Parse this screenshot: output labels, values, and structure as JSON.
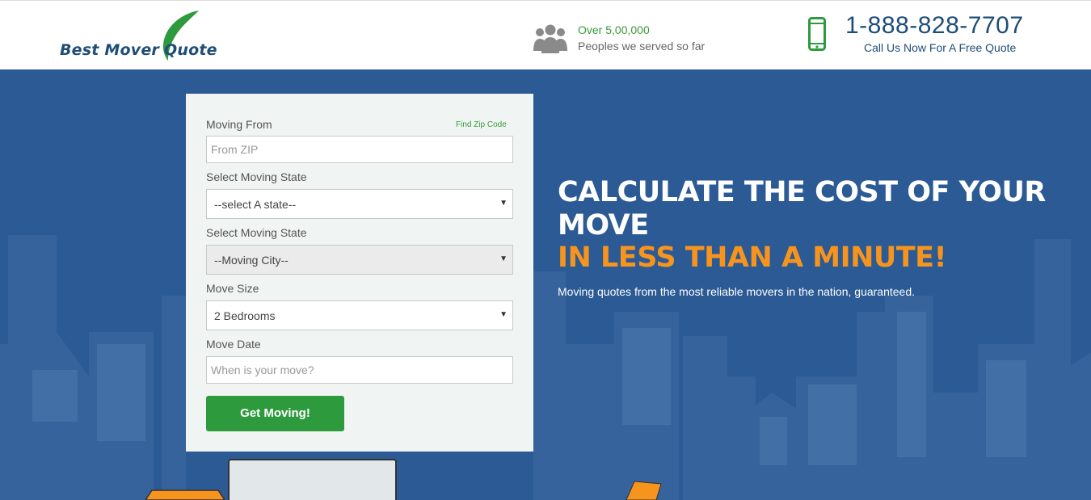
{
  "header": {
    "logo": {
      "word1": "Best Mover",
      "word2": "Quote",
      "accent_color": "#2e9a3e",
      "text_color": "#1e4d78"
    },
    "served": {
      "icon": "people-group-icon",
      "count": "Over 5,00,000",
      "subtitle": "Peoples we served so far"
    },
    "phone": {
      "icon": "mobile-phone-icon",
      "number": "1-888-828-7707",
      "cta": "Call Us Now For A Free Quote"
    }
  },
  "form": {
    "moving_from_label": "Moving From",
    "find_zip_link": "Find Zip Code",
    "from_zip_placeholder": "From ZIP",
    "state_label": "Select Moving State",
    "state_value": "--select A state--",
    "city_label": "Select Moving State",
    "city_value": "--Moving City--",
    "size_label": "Move Size",
    "size_value": "2 Bedrooms",
    "date_label": "Move Date",
    "date_placeholder": "When is your move?",
    "submit_label": "Get Moving!"
  },
  "hero": {
    "title_line1": "CALCULATE THE COST OF YOUR MOVE",
    "title_line2": "IN LESS THAN A MINUTE!",
    "subtitle": "Moving quotes from the most reliable movers in the nation, guaranteed.",
    "background_color": "#2b5a94",
    "highlight_color": "#f7941d"
  }
}
